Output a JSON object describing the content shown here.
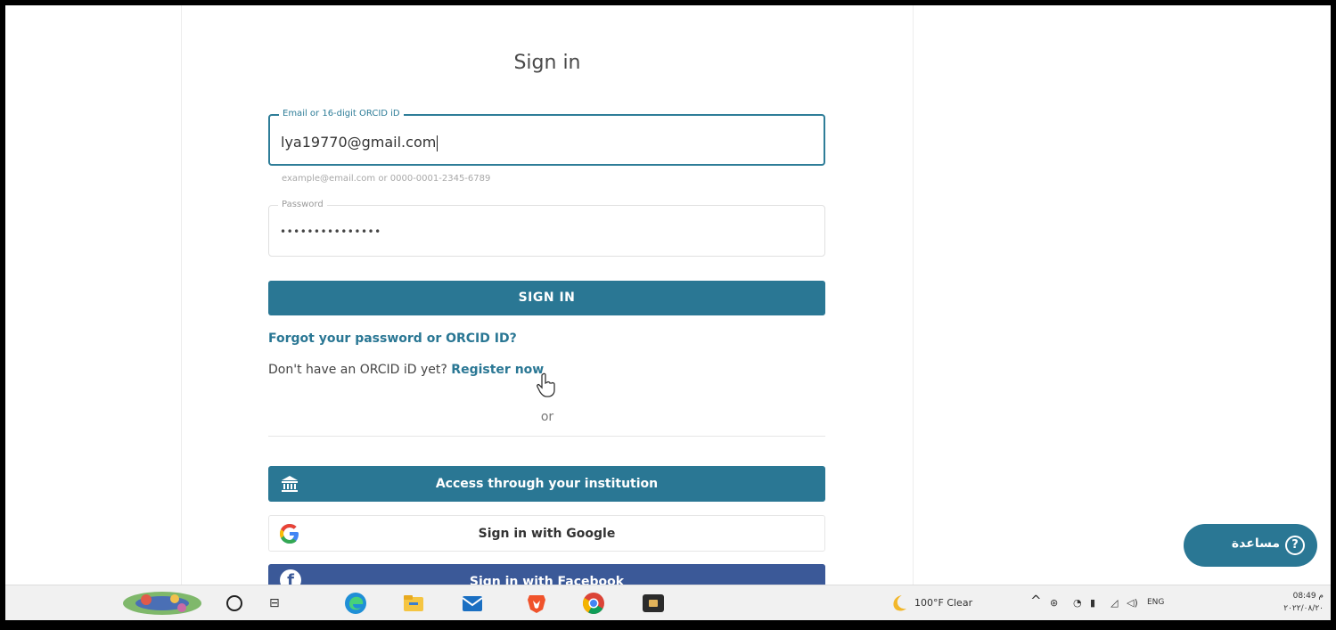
{
  "page": {
    "title": "Sign in"
  },
  "form": {
    "email_legend": "Email or 16-digit ORCID iD",
    "email_value": "lya19770@gmail.com",
    "email_hint": "example@email.com or 0000-0001-2345-6789",
    "password_legend": "Password",
    "password_value": "•••••••••••••••",
    "signin_label": "SIGN IN"
  },
  "links": {
    "forgot": "Forgot your password or ORCID ID?",
    "register_prefix": "Don't have an ORCID iD yet?",
    "register": "Register now",
    "or": "or"
  },
  "alt_signin": {
    "institution": "Access through your institution",
    "google": "Sign in with Google",
    "facebook": "Sign in with Facebook"
  },
  "help": {
    "label": "مساعدة",
    "icon": "?"
  },
  "taskbar": {
    "weather": "100°F  Clear",
    "language": "ENG",
    "time": "08:49 م",
    "date": "٢٠٢٢/٠٨/٢٠"
  },
  "colors": {
    "accent": "#2a7794",
    "facebook": "#3b5998"
  }
}
